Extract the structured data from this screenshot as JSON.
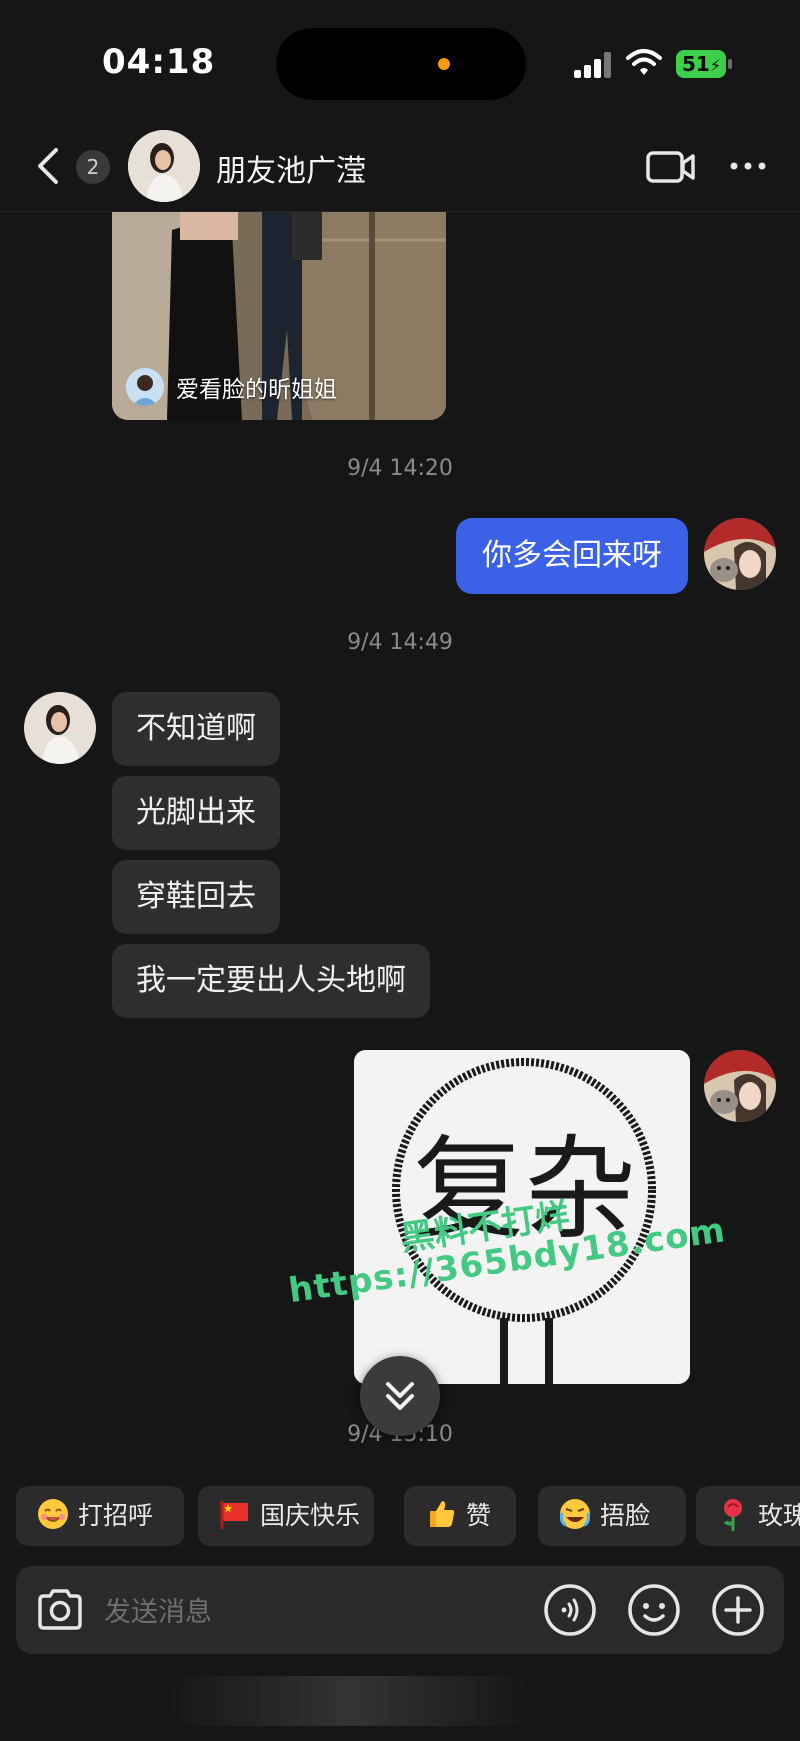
{
  "status_bar": {
    "time": "04:18",
    "battery": "51"
  },
  "header": {
    "unread_count": "2",
    "contact_name": "朋友池广滢"
  },
  "shared_post": {
    "author": "爱看脸的昕姐姐"
  },
  "messages": {
    "ts1": "9/4 14:20",
    "outgoing1": "你多会回来呀",
    "ts2": "9/4 14:49",
    "incoming": [
      "不知道啊",
      "光脚出来",
      "穿鞋回去",
      "我一定要出人头地啊"
    ],
    "sticker_text": "复杂",
    "ts3": "9/4 15:10"
  },
  "watermark": {
    "line1": "黑料不打烊",
    "line2": "https://365bdy18.com"
  },
  "quick_replies": [
    {
      "label": "打招呼",
      "icon": "smile-face-icon"
    },
    {
      "label": "国庆快乐",
      "icon": "red-flag-icon"
    },
    {
      "label": "赞",
      "icon": "thumbs-up-icon"
    },
    {
      "label": "捂脸",
      "icon": "facepalm-icon"
    },
    {
      "label": "玫瑰",
      "icon": "rose-icon"
    }
  ],
  "input": {
    "placeholder": "发送消息"
  },
  "colors": {
    "bubble_out": "#3b62e6",
    "bubble_in": "#2e2e2e",
    "background": "#161616",
    "watermark": "#44c983"
  }
}
